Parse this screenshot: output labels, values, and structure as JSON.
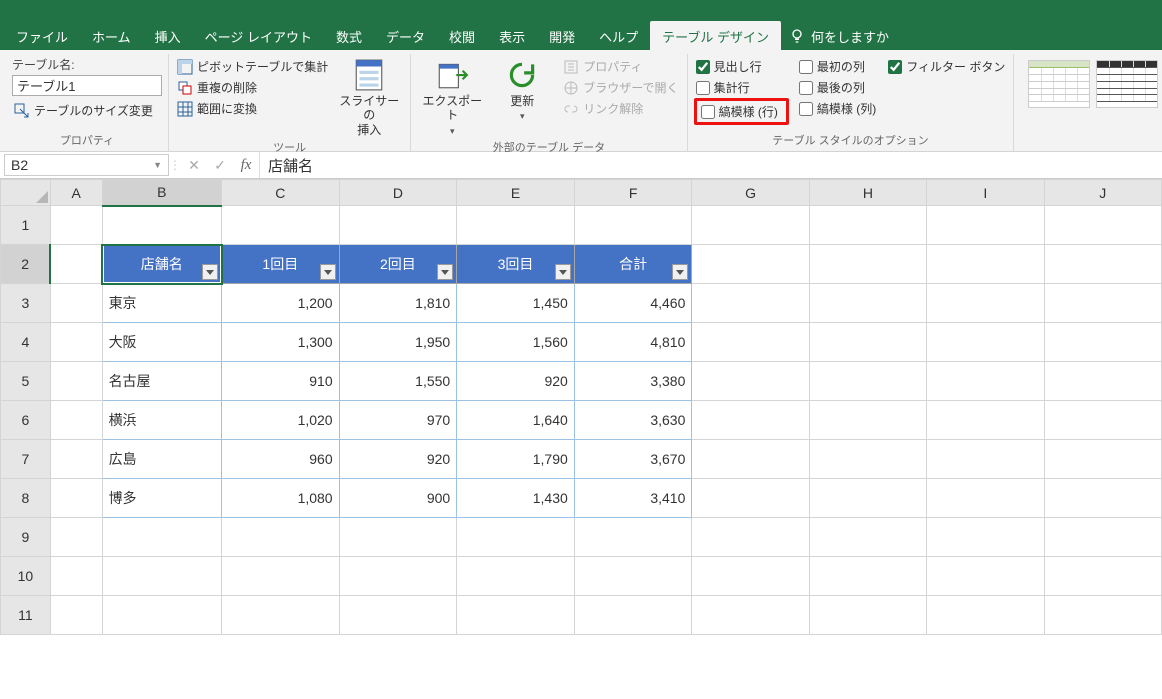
{
  "tabs": {
    "file": "ファイル",
    "home": "ホーム",
    "insert": "挿入",
    "pagelayout": "ページ レイアウト",
    "formulas": "数式",
    "data": "データ",
    "review": "校閲",
    "view": "表示",
    "dev": "開発",
    "help": "ヘルプ",
    "tabledesign": "テーブル デザイン"
  },
  "tellme": "何をしますか",
  "group_properties": {
    "table_name_label": "テーブル名:",
    "table_name_value": "テーブル1",
    "resize": "テーブルのサイズ変更",
    "label": "プロパティ"
  },
  "group_tools": {
    "pivot": "ピボットテーブルで集計",
    "dups": "重複の削除",
    "convert": "範囲に変換",
    "slicer": "スライサーの\n挿入",
    "label": "ツール"
  },
  "group_extern": {
    "export": "エクスポート",
    "refresh": "更新",
    "properties": "プロパティ",
    "browser": "ブラウザーで開く",
    "unlink": "リンク解除",
    "label": "外部のテーブル データ"
  },
  "group_styleopts": {
    "header_row": "見出し行",
    "total_row": "集計行",
    "banded_rows": "縞模様 (行)",
    "first_col": "最初の列",
    "last_col": "最後の列",
    "banded_cols": "縞模様 (列)",
    "filter_btn": "フィルター ボタン",
    "label": "テーブル スタイルのオプション"
  },
  "namebox": "B2",
  "formula": "店舗名",
  "columns": [
    "A",
    "B",
    "C",
    "D",
    "E",
    "F",
    "G",
    "H",
    "I",
    "J"
  ],
  "rows": [
    "1",
    "2",
    "3",
    "4",
    "5",
    "6",
    "7",
    "8",
    "9",
    "10",
    "11"
  ],
  "table": {
    "headers": [
      "店舗名",
      "1回目",
      "2回目",
      "3回目",
      "合計"
    ],
    "data": [
      [
        "東京",
        "1,200",
        "1,810",
        "1,450",
        "4,460"
      ],
      [
        "大阪",
        "1,300",
        "1,950",
        "1,560",
        "4,810"
      ],
      [
        "名古屋",
        "910",
        "1,550",
        "920",
        "3,380"
      ],
      [
        "横浜",
        "1,020",
        "970",
        "1,640",
        "3,630"
      ],
      [
        "広島",
        "960",
        "920",
        "1,790",
        "3,670"
      ],
      [
        "博多",
        "1,080",
        "900",
        "1,430",
        "3,410"
      ]
    ]
  }
}
